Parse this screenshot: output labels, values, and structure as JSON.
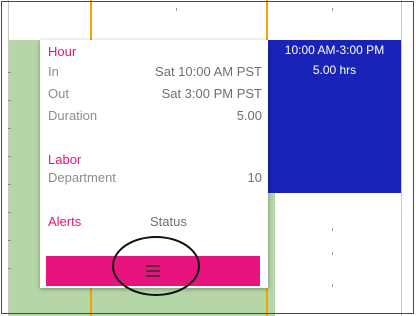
{
  "shift": {
    "time_range": "10:00 AM-3:00 PM",
    "hours": "5.00 hrs",
    "color": "#1a23b8"
  },
  "popup": {
    "hour": {
      "title": "Hour",
      "in_label": "In",
      "in_value": "Sat 10:00 AM PST",
      "out_label": "Out",
      "out_value": "Sat 3:00 PM PST",
      "duration_label": "Duration",
      "duration_value": "5.00"
    },
    "labor": {
      "title": "Labor",
      "department_label": "Department",
      "department_value": "10"
    },
    "alerts": {
      "title": "Alerts",
      "status_label": "Status"
    },
    "action_bar": {
      "icon": "menu-icon",
      "color": "#e8147d"
    }
  }
}
